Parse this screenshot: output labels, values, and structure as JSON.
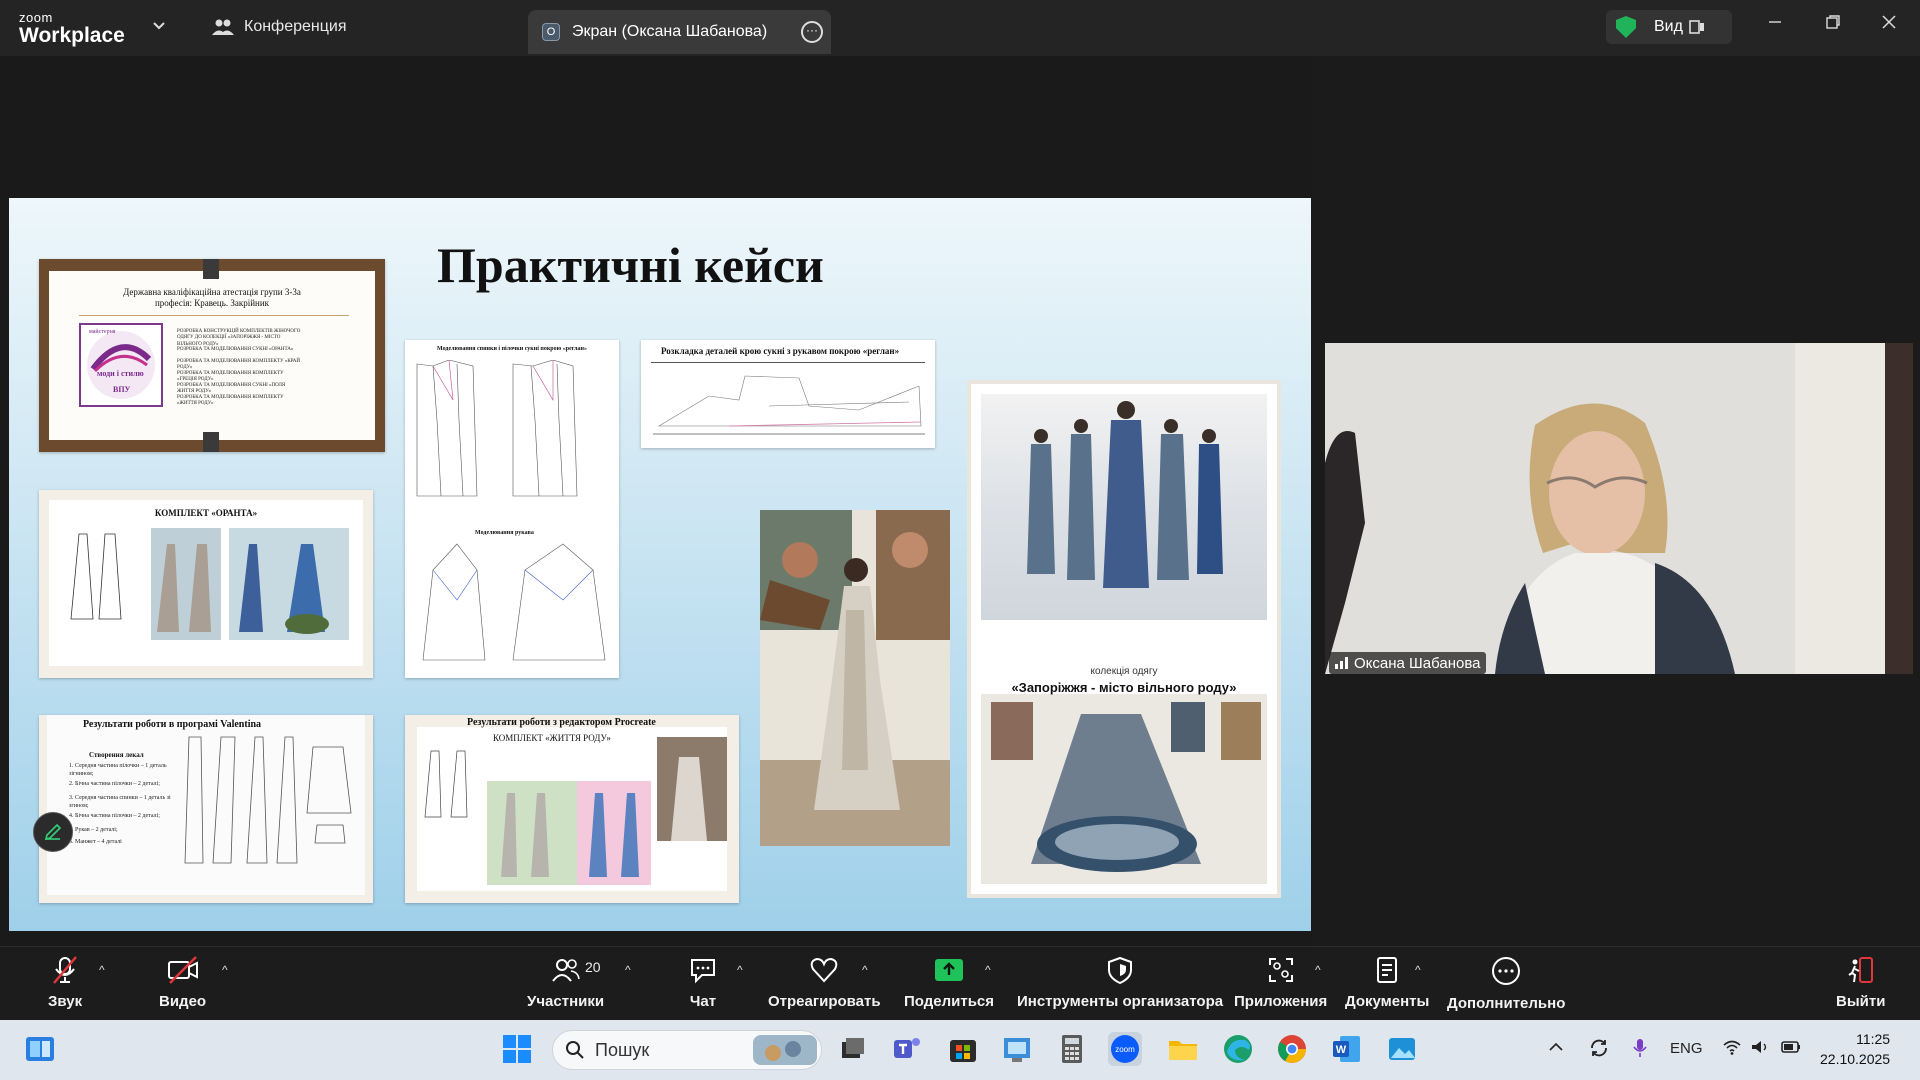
{
  "app": {
    "brand_small": "zoom",
    "brand_big": "Workplace"
  },
  "tabs": {
    "conference": "Конференция",
    "share_title": "Экран (Оксана Шабанова)",
    "share_badge": "O"
  },
  "header": {
    "view_label": "Вид"
  },
  "slide": {
    "title": "Практичні кейси",
    "frame1": {
      "heading1": "Державна кваліфікаційна атестація групи 3-3а",
      "heading2": "професія: Кравець. Закрійник",
      "logo_top": "майстерня",
      "logo_mid": "моди і стилю",
      "logo_bottom": "ВПУ",
      "lines": [
        "РОЗРОБКА КОНСТРУКЦІЙ КОМПЛЕКТІВ ЖІНОЧОГО ОДЯГУ ДО КОЛЕКЦІЇ «ЗАПОРІЖЖЯ - МІСТО ВІЛЬНОГО РОДУ»",
        "РОЗРОБКА ТА МОДЕЛЮВАННЯ СУКНІ «ОРАНТА»",
        "РОЗРОБКА ТА МОДЕЛЮВАННЯ КОМПЛЕКТУ «КРАЙ РОДУ»",
        "РОЗРОБКА ТА МОДЕЛЮВАННЯ КОМПЛЕКТУ «ГРЕЦІЯ РОДУ»",
        "РОЗРОБКА ТА МОДЕЛЮВАННЯ СУКНІ «ПОЛЯ ЖИТТЯ РОДУ»",
        "РОЗРОБКА ТА МОДЕЛЮВАННЯ КОМПЛЕКТУ «ЖИТТЯ РОДУ»"
      ]
    },
    "frame2_title": "КОМПЛЕКТ «ОРАНТА»",
    "frame3_title": "Результати роботи в програмі Valentina",
    "frame3_subtitle": "Створення лекал",
    "frame3_items": [
      "1. Середня частина пілочки – 1 деталь зігнином;",
      "2. Бічна частина пілочки – 2 деталі;",
      "3. Середня частина спинки – 1 деталь зі згином;",
      "4. Бічна частина пілочки – 2 деталі;",
      "5. Рукав – 2 деталі;",
      "6. Манжет – 4 деталі"
    ],
    "frame4_title": "Результати роботи з редактором Procreate",
    "frame4_subtitle": "КОМПЛЕКТ «ЖИТТЯ РОДУ»",
    "pattern_title": "Моделювання спинки і пілочки сукні покрою «реглан»",
    "pattern_sleeve": "Моделювання рукава",
    "layout_title": "Розкладка деталей крою сукні з рукавом покрою «реглан»",
    "poster_small": "колекція одягу",
    "poster_big": "«Запоріжжя - місто вільного роду»"
  },
  "video": {
    "participant_name": "Оксана Шабанова"
  },
  "toolbar": {
    "audio": "Звук",
    "video": "Видео",
    "participants": "Участники",
    "participants_count": "20",
    "chat": "Чат",
    "react": "Отреагировать",
    "share": "Поделиться",
    "host_tools": "Инструменты организатора",
    "apps": "Приложения",
    "docs": "Документы",
    "more": "Дополнительно",
    "leave": "Выйти"
  },
  "taskbar": {
    "search_placeholder": "Пошук",
    "lang": "ENG",
    "time": "11:25",
    "date": "22.10.2025"
  },
  "colors": {
    "accent_green": "#21b35a",
    "share_green": "#1fc35a",
    "leave_red": "#e0373b",
    "mute_red": "#e0373b"
  }
}
